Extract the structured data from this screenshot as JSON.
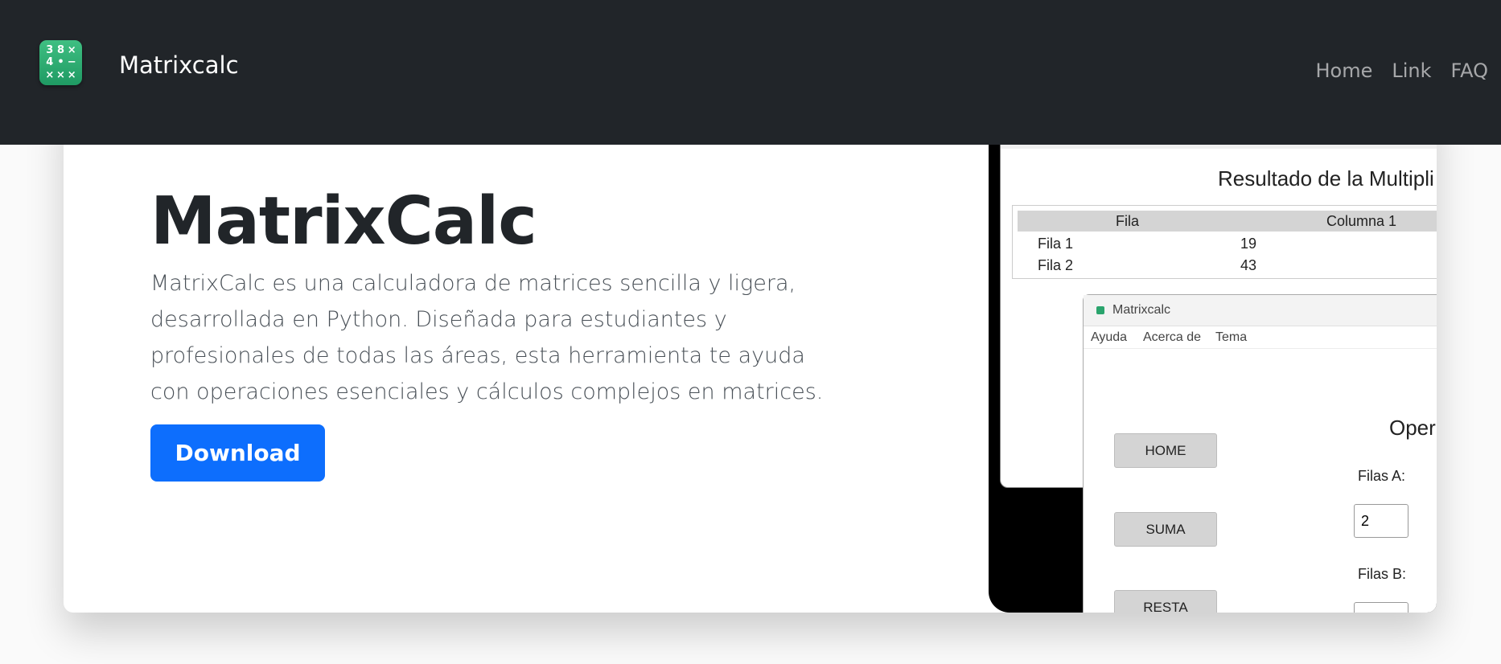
{
  "navbar": {
    "brand": "Matrixcalc",
    "logo_glyphs": [
      "3",
      "8",
      "×",
      "4",
      "•",
      "−",
      "×",
      "×",
      "×"
    ],
    "links": [
      "Home",
      "Link",
      "FAQ"
    ]
  },
  "hero": {
    "title": "MatrixCalc",
    "description": "MatrixCalc es una calculadora de matrices sencilla y ligera, desarrollada en Python. Diseñada para estudiantes y profesionales de todas las áreas, esta herramienta te ayuda con operaciones esenciales y cálculos complejos en matrices.",
    "download_label": "Download"
  },
  "screenshot": {
    "result_window": {
      "title": "Resultado de la Multipli",
      "columns": [
        "Fila",
        "Columna 1"
      ],
      "rows": [
        {
          "label": "Fila 1",
          "value": "19"
        },
        {
          "label": "Fila 2",
          "value": "43"
        }
      ]
    },
    "app_window": {
      "title": "Matrixcalc",
      "menu": [
        "Ayuda",
        "Acerca de",
        "Tema"
      ],
      "buttons": [
        "HOME",
        "SUMA",
        "RESTA"
      ],
      "ops_title": "Oper",
      "filas_a_label": "Filas A:",
      "filas_a_value": "2",
      "filas_b_label": "Filas B:"
    }
  },
  "colors": {
    "navbar_bg": "#212529",
    "primary": "#0d6efd",
    "logo_green": "#2aa46d"
  }
}
